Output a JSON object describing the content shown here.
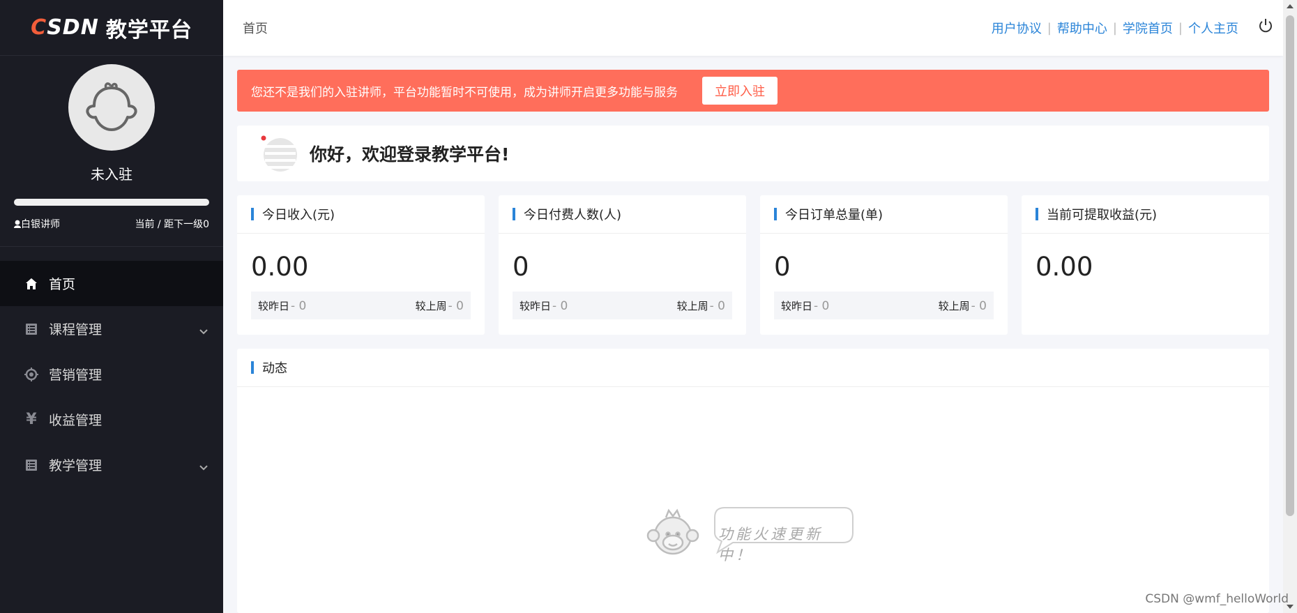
{
  "logo": {
    "c": "C",
    "sdn": "SDN",
    "text": "教学平台"
  },
  "user": {
    "name": "未入驻",
    "level": "白银讲师",
    "progress_text": "当前 / 距下一级0",
    "progress": 1.0
  },
  "menu": [
    {
      "label": "首页",
      "icon": "home-icon",
      "active": true,
      "expandable": false
    },
    {
      "label": "课程管理",
      "icon": "list-icon",
      "active": false,
      "expandable": true
    },
    {
      "label": "营销管理",
      "icon": "target-icon",
      "active": false,
      "expandable": false
    },
    {
      "label": "收益管理",
      "icon": "yen-icon",
      "active": false,
      "expandable": false
    },
    {
      "label": "教学管理",
      "icon": "list-icon",
      "active": false,
      "expandable": true
    }
  ],
  "topbar": {
    "breadcrumb": "首页",
    "links": [
      "用户协议",
      "帮助中心",
      "学院首页",
      "个人主页"
    ],
    "separator": "|"
  },
  "banner": {
    "text": "您还不是我们的入驻讲师，平台功能暂时不可使用，成为讲师开启更多功能与服务",
    "button": "立即入驻"
  },
  "welcome": {
    "text": "你好，欢迎登录教学平台!"
  },
  "stats": [
    {
      "title": "今日收入(元)",
      "value": "0.00",
      "yesterday_label": "较昨日",
      "yesterday": "- 0",
      "lastweek_label": "较上周",
      "lastweek": "- 0"
    },
    {
      "title": "今日付费人数(人)",
      "value": "0",
      "yesterday_label": "较昨日",
      "yesterday": "- 0",
      "lastweek_label": "较上周",
      "lastweek": "- 0"
    },
    {
      "title": "今日订单总量(单)",
      "value": "0",
      "yesterday_label": "较昨日",
      "yesterday": "- 0",
      "lastweek_label": "较上周",
      "lastweek": "- 0"
    },
    {
      "title": "当前可提取收益(元)",
      "value": "0.00"
    }
  ],
  "dynamics": {
    "title": "动态",
    "empty_text": "功能火速更新中！"
  },
  "watermark": "CSDN @wmf_helloWorld",
  "colors": {
    "sidebar": "#1b1c24",
    "accent": "#2a84d8",
    "banner": "#ff6e5b",
    "brand": "#f25d3a"
  }
}
